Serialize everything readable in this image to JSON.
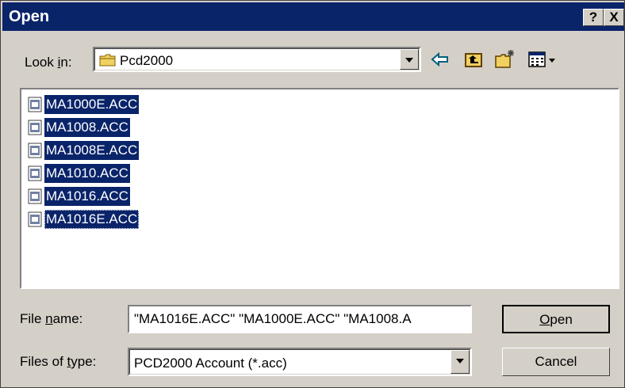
{
  "window": {
    "title": "Open",
    "help_label": "?",
    "close_label": "X"
  },
  "look_in": {
    "label_pre": "Look ",
    "label_key": "i",
    "label_post": "n:",
    "value": "Pcd2000",
    "icon": "folder-icon"
  },
  "toolbar": {
    "back_icon": "back-arrow-icon",
    "up_icon": "up-folder-icon",
    "new_folder_icon": "new-folder-icon",
    "view_icon": "view-menu-icon"
  },
  "files": [
    {
      "name": "MA1000E.ACC"
    },
    {
      "name": "MA1008.ACC"
    },
    {
      "name": "MA1008E.ACC"
    },
    {
      "name": "MA1010.ACC"
    },
    {
      "name": "MA1016.ACC"
    },
    {
      "name": "MA1016E.ACC"
    }
  ],
  "file_name": {
    "label_pre": "File ",
    "label_key": "n",
    "label_post": "ame:",
    "value": "\"MA1016E.ACC\" \"MA1000E.ACC\" \"MA1008.A"
  },
  "file_type": {
    "label_pre": "Files of ",
    "label_key": "t",
    "label_post": "ype:",
    "value": "PCD2000 Account (*.acc)"
  },
  "buttons": {
    "open_key": "O",
    "open_rest": "pen",
    "cancel": "Cancel"
  },
  "colors": {
    "title_bg": "#0a246a",
    "face": "#d4d0c8",
    "selection": "#0a246a"
  }
}
